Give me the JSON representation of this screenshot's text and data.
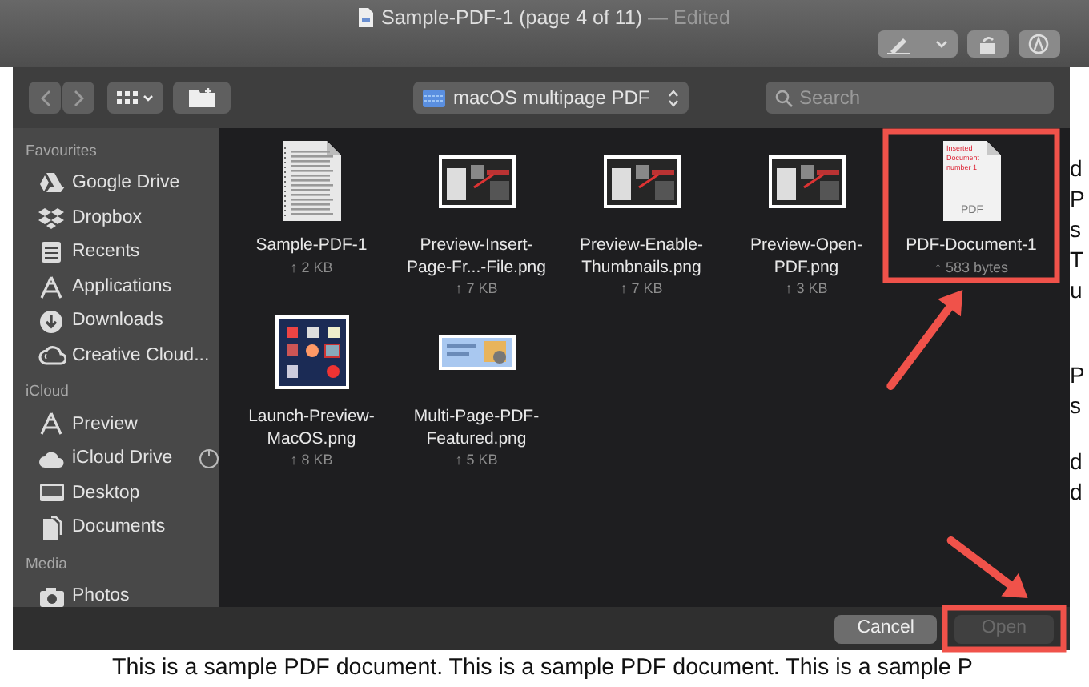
{
  "window": {
    "title": "Sample-PDF-1 (page 4 of 11)",
    "status": "— Edited"
  },
  "dialog": {
    "location": "macOS multipage PDF",
    "search": {
      "placeholder": "Search"
    },
    "sidebar": [
      {
        "heading": "Favourites",
        "items": [
          {
            "label": "Google Drive",
            "kind": "drive"
          },
          {
            "label": "Dropbox",
            "kind": "dropbox"
          },
          {
            "label": "Recents",
            "kind": "recents"
          },
          {
            "label": "Applications",
            "kind": "apps"
          },
          {
            "label": "Downloads",
            "kind": "download"
          },
          {
            "label": "Creative Cloud...",
            "kind": "cc"
          }
        ]
      },
      {
        "heading": "iCloud",
        "items": [
          {
            "label": "Preview",
            "kind": "apps"
          },
          {
            "label": "iCloud Drive",
            "kind": "cloud",
            "syncing": true
          },
          {
            "label": "Desktop",
            "kind": "desktop"
          },
          {
            "label": "Documents",
            "kind": "documents"
          }
        ]
      },
      {
        "heading": "Media",
        "items": [
          {
            "label": "Photos",
            "kind": "camera"
          }
        ]
      }
    ],
    "files": [
      {
        "name_lines": [
          "Sample-PDF-1"
        ],
        "size": "↑ 2 KB",
        "kind": "document",
        "highlighted": false
      },
      {
        "name_lines": [
          "Preview-Insert-",
          "Page-Fr...-File.png"
        ],
        "size": "↑ 7 KB",
        "kind": "screenshot",
        "highlighted": false
      },
      {
        "name_lines": [
          "Preview-Enable-",
          "Thumbnails.png"
        ],
        "size": "↑ 7 KB",
        "kind": "screenshot",
        "highlighted": false
      },
      {
        "name_lines": [
          "Preview-Open-",
          "PDF.png"
        ],
        "size": "↑ 3 KB",
        "kind": "screenshot",
        "highlighted": false
      },
      {
        "name_lines": [
          "PDF-Document-1"
        ],
        "size": "↑ 583 bytes",
        "kind": "pdf",
        "icon_lines": [
          "Inserted",
          "Document",
          "number 1"
        ],
        "icon_badge": "PDF",
        "highlighted": true
      },
      {
        "name_lines": [
          "Launch-Preview-",
          "MacOS.png"
        ],
        "size": "↑ 8 KB",
        "kind": "square",
        "highlighted": false
      },
      {
        "name_lines": [
          "Multi-Page-PDF-",
          "Featured.png"
        ],
        "size": "↑ 5 KB",
        "kind": "banner",
        "highlighted": false
      }
    ],
    "buttons": [
      {
        "label": "Cancel",
        "disabled": false,
        "highlighted": false
      },
      {
        "label": "Open",
        "disabled": true,
        "highlighted": true
      }
    ]
  },
  "document": {
    "edge_letters": [
      "d",
      "P",
      "s",
      "T",
      "u",
      "P",
      "s",
      "d",
      "d"
    ],
    "line": "This is a sample PDF document. This is a sample PDF document. This is a sample P"
  }
}
